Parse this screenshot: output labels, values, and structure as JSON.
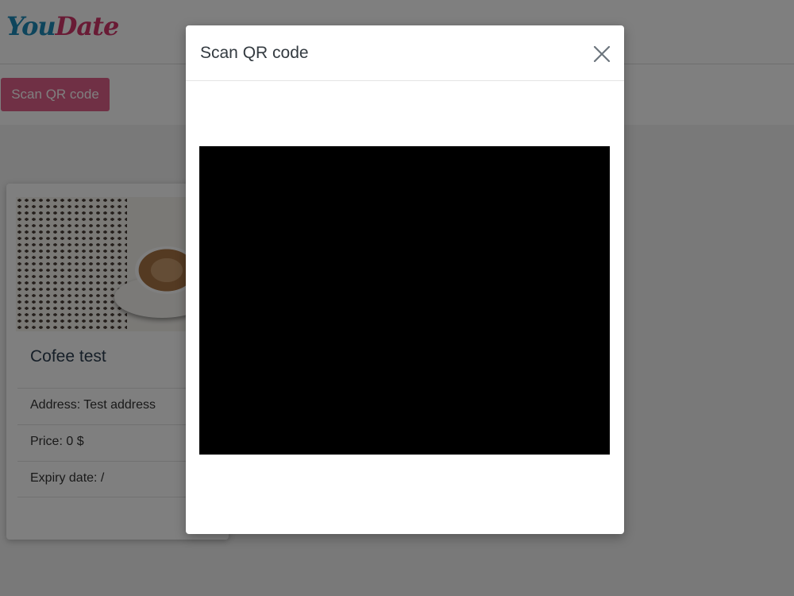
{
  "logo": {
    "part1": "You",
    "part2": "Date"
  },
  "toolbar": {
    "scan_button_label": "Scan QR code"
  },
  "card": {
    "title": "Cofee test",
    "image_icon": "coffee-cup-photo",
    "address": "Address: Test address",
    "price": "Price: 0 $",
    "expiry": "Expiry date: /"
  },
  "modal": {
    "title": "Scan QR code",
    "close_icon": "close-icon"
  },
  "colors": {
    "brand_blue": "#1c8bb8",
    "brand_pink": "#d3376b",
    "button_pink": "#e0608a"
  }
}
